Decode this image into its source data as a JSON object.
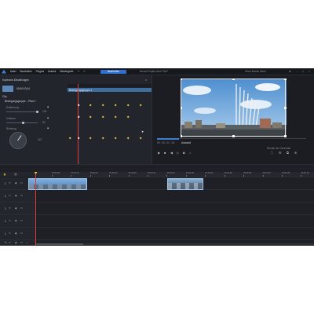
{
  "menu": [
    "Datei",
    "Bearbeiten",
    "Plugins",
    "Ansicht",
    "Wiedergabe"
  ],
  "top_button": "Bearbeiten",
  "window_title": "Neues Projekt ohne Titel*",
  "top_right_text": "Ohne Maske Menü",
  "left_panel": {
    "title": "Keyframe-Einstellungen",
    "close": "×",
    "clip_time": "00:00:10;04",
    "clip_bar_label": "Bewegungsgruppe 1",
    "group_header": "Clip",
    "subgroup": "Bewegungsgruppe – Pfad 1",
    "param1_label": "Entfernung",
    "param1_value": "100",
    "param2_label": "Zentrum",
    "param2_value": "50",
    "param3_label": "Richtung",
    "param3_value": "167"
  },
  "preview": {
    "timecode": "00 : 00 : 01 : 04",
    "quality": "Auswahl",
    "render_label": "Render der Vorschau"
  },
  "toolbar": {
    "tab1": "Clips",
    "tab2": "Werkzeuge",
    "tab3": "Ausgabe/Bildschirm",
    "button": "Bearbeiten"
  },
  "ruler_ticks": [
    "00:00:05",
    "00:00:10",
    "00:00:15",
    "00:00:20",
    "00:00:25",
    "00:00:30",
    "00:00:35",
    "00:00:40",
    "00:00:45",
    "00:00:50",
    "00:00:55",
    "00:01:00",
    "00:01:05",
    "00:01:10"
  ],
  "track_labels": [
    "1",
    "1",
    "1",
    "1",
    "1",
    "1"
  ],
  "colors": {
    "accent": "#2f6fcf",
    "keyframe": "#f4c430",
    "playhead": "#e23b3b",
    "clip": "#4a7fb5"
  }
}
